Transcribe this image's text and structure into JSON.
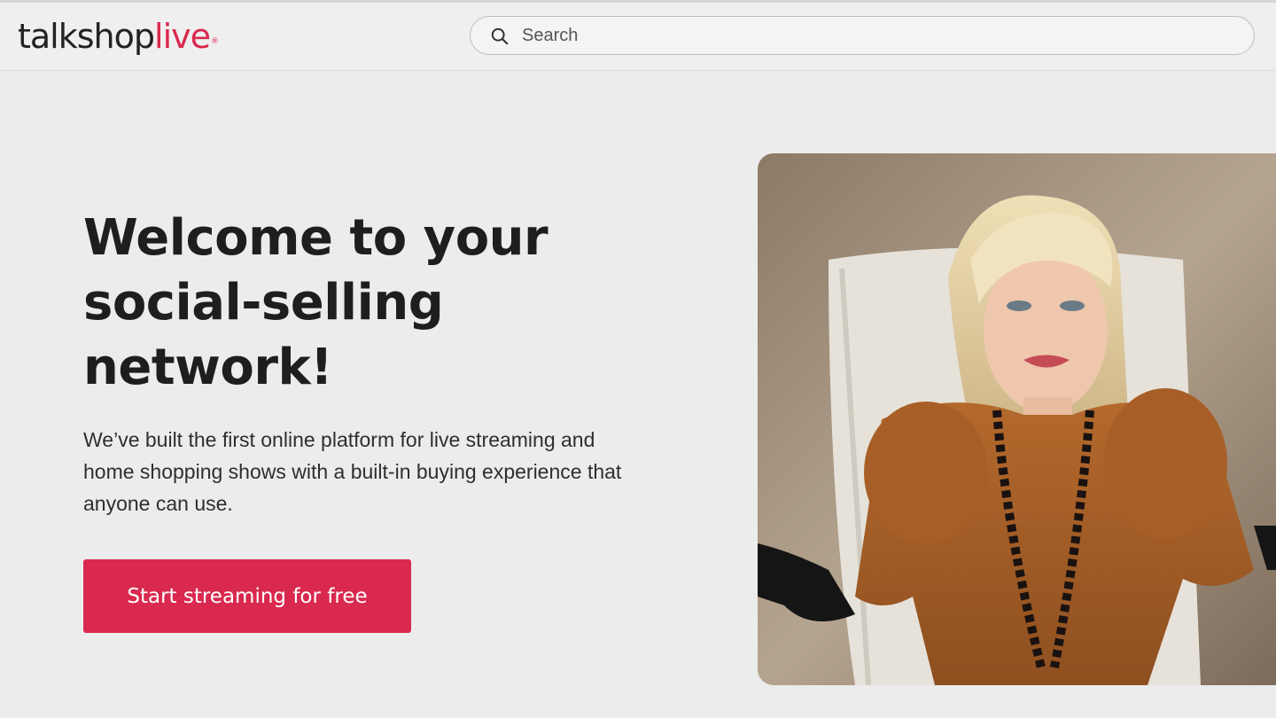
{
  "header": {
    "logo": {
      "part1": "talkshop",
      "part2": "live",
      "mark": "®"
    },
    "search": {
      "placeholder": "Search",
      "value": ""
    }
  },
  "hero": {
    "title": "Welcome to your social-selling network!",
    "subtitle": "We’ve built the first online platform for live streaming and home shopping shows with a built-in buying experience that anyone can use.",
    "cta_label": "Start streaming for free"
  },
  "colors": {
    "brand": "#d9294e",
    "background": "#ececec",
    "text": "#1e1e1e"
  },
  "icons": {
    "search": "search-icon"
  }
}
